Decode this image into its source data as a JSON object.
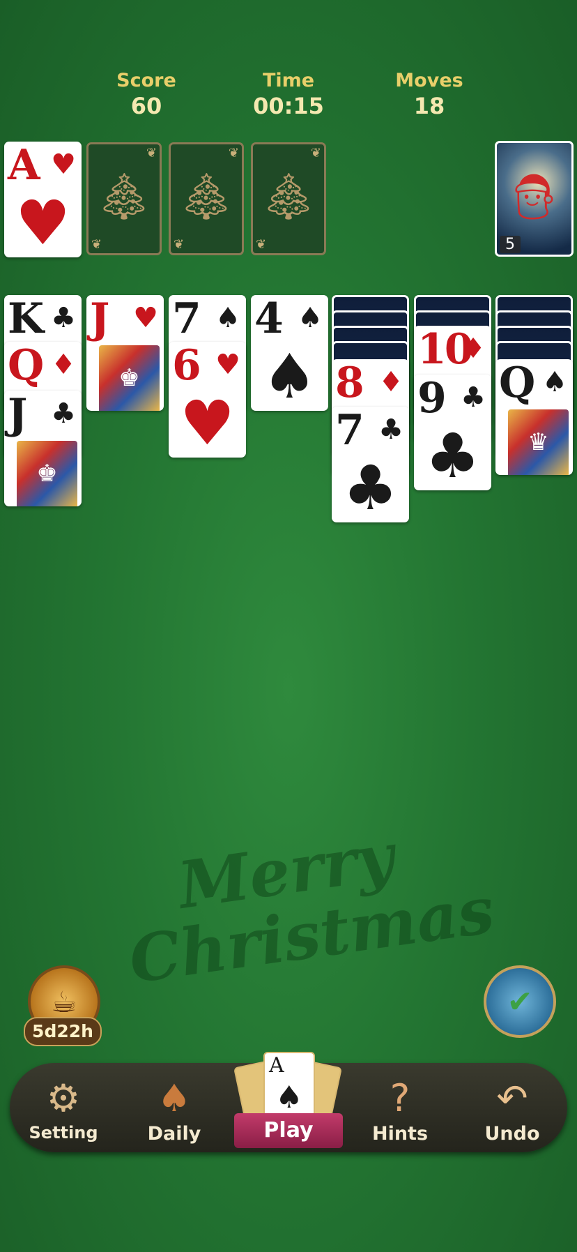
{
  "stats": {
    "score_label": "Score",
    "score_value": "60",
    "time_label": "Time",
    "time_value": "00:15",
    "moves_label": "Moves",
    "moves_value": "18"
  },
  "foundation": [
    {
      "rank": "A",
      "suit": "♥",
      "color": "red"
    },
    {
      "empty": true,
      "icon": "tree-icon"
    },
    {
      "empty": true,
      "icon": "tree-icon"
    },
    {
      "empty": true,
      "icon": "tree-icon"
    }
  ],
  "stock": {
    "count": "5",
    "art": "santa-icon"
  },
  "tableau": {
    "col1": [
      {
        "rank": "K",
        "suit": "♣"
      },
      {
        "rank": "Q",
        "suit": "♦"
      },
      {
        "rank": "J",
        "suit": "♣"
      }
    ],
    "col2": [
      {
        "rank": "J",
        "suit": "♥"
      }
    ],
    "col3": [
      {
        "rank": "7",
        "suit": "♠"
      },
      {
        "rank": "6",
        "suit": "♥"
      }
    ],
    "col4": [
      {
        "rank": "4",
        "suit": "♠"
      }
    ],
    "col5": [
      {
        "rank": "8",
        "suit": "♦"
      },
      {
        "rank": "7",
        "suit": "♣"
      }
    ],
    "col6": [
      {
        "rank": "10",
        "suit": "♦"
      },
      {
        "rank": "9",
        "suit": "♣"
      }
    ],
    "col7": [
      {
        "rank": "Q",
        "suit": "♠"
      }
    ]
  },
  "watermark": {
    "line1": "Merry",
    "line2": "Christmas"
  },
  "event": {
    "timer": "5d22h"
  },
  "nav": {
    "setting": "Setting",
    "daily": "Daily",
    "play": "Play",
    "play_card_rank": "A",
    "play_card_suit": "♠",
    "hints": "Hints",
    "undo": "Undo"
  },
  "icons": {
    "setting": "gear-icon",
    "daily": "calendar-icon",
    "hints": "lightbulb-icon",
    "undo": "undo-arrow-icon",
    "event": "coffee-puzzle-icon",
    "tasks": "clipboard-check-icon"
  },
  "colors": {
    "table": "#237532",
    "red_suit": "#c8161d",
    "gold_text": "#e8cf6a"
  }
}
